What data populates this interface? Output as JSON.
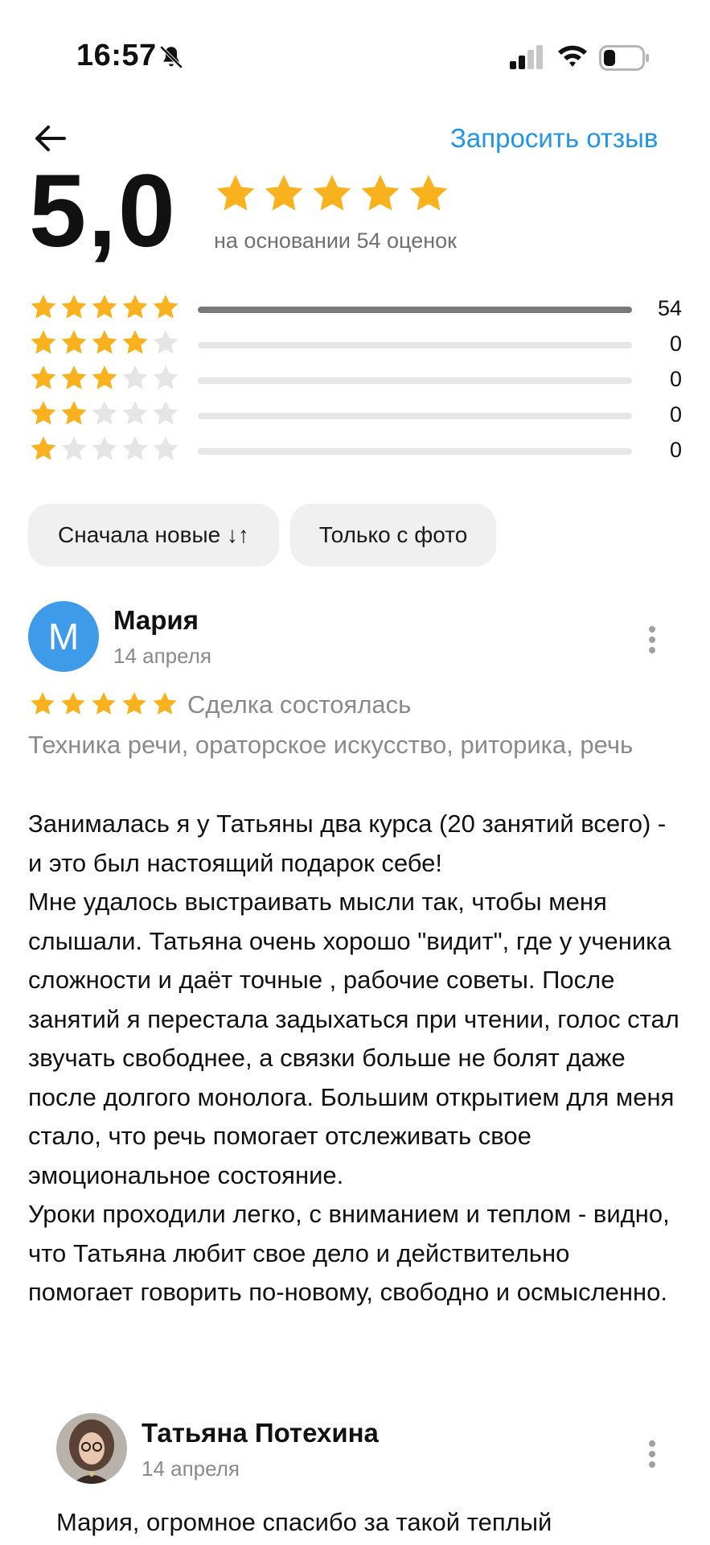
{
  "status_bar": {
    "time": "16:57"
  },
  "header": {
    "request_review": "Запросить отзыв"
  },
  "summary": {
    "rating": "5,0",
    "stars": 5,
    "basis_text": "на основании 54 оценок"
  },
  "distribution": [
    {
      "stars": 5,
      "count": "54",
      "fraction": 1.0
    },
    {
      "stars": 4,
      "count": "0",
      "fraction": 0
    },
    {
      "stars": 3,
      "count": "0",
      "fraction": 0
    },
    {
      "stars": 2,
      "count": "0",
      "fraction": 0
    },
    {
      "stars": 1,
      "count": "0",
      "fraction": 0
    }
  ],
  "filters": {
    "sort_label": "Сначала новые ↓↑",
    "photo_label": "Только с фото"
  },
  "review": {
    "avatar_letter": "М",
    "author": "Мария",
    "date": "14 апреля",
    "stars": 5,
    "deal_status": "Сделка состоялась",
    "service": "Техника речи, ораторское искусство, риторика, речь",
    "paragraphs": [
      "Занималась я у Татьяны два курса (20 занятий всего) - и это был настоящий подарок себе!",
      "Мне удалось выстраивать мысли так, чтобы меня слышали. Татьяна очень хорошо \"видит\", где у ученика сложности и даёт точные , рабочие советы. После занятий я перестала задыхаться при чтении, голос стал звучать свободнее, а связки больше не болят даже после долгого монолога. Большим открытием для меня стало, что речь помогает отслеживать свое эмоциональное состояние.",
      "Уроки проходили легко, с вниманием и теплом - видно, что Татьяна любит свое дело и действительно помогает говорить по-новому, свободно и осмысленно."
    ]
  },
  "reply": {
    "author": "Татьяна Потехина",
    "date": "14 апреля",
    "text": "Мария, огромное спасибо за такой теплый"
  },
  "colors": {
    "star": "#f9b21d",
    "star_empty": "#e5e5e5",
    "link": "#2196e8",
    "avatar": "#3d9bea"
  }
}
